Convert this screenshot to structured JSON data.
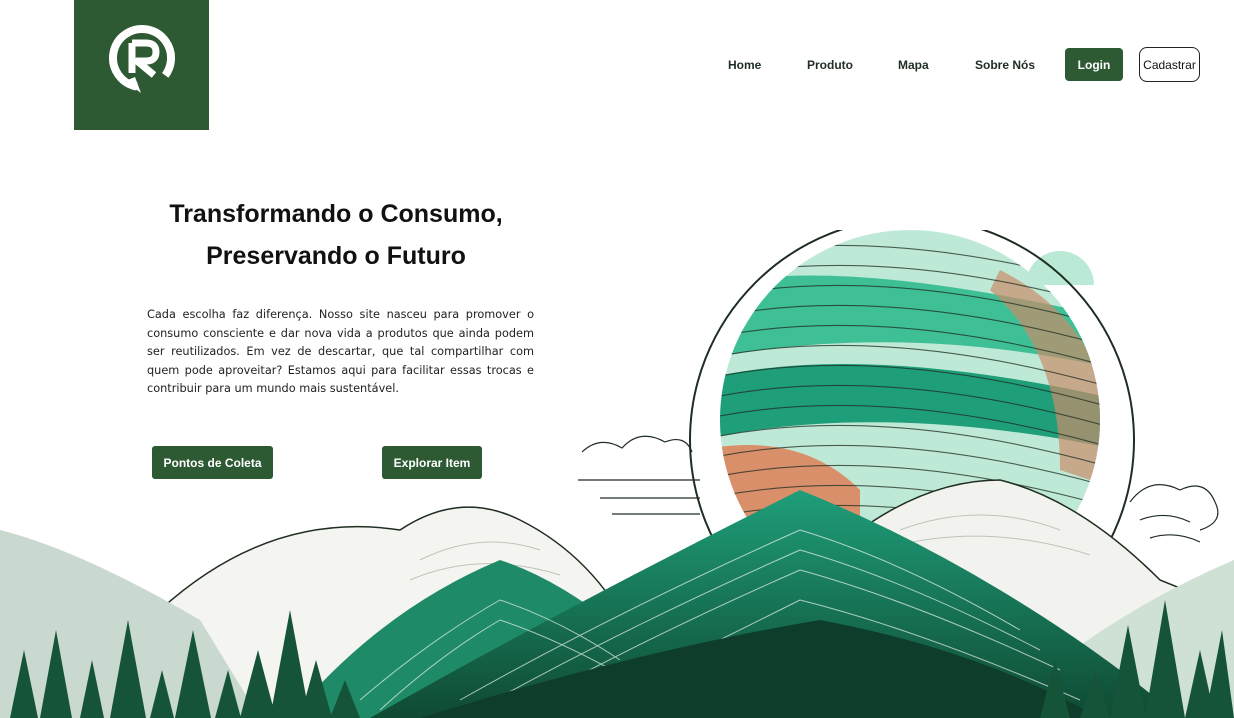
{
  "brand": {
    "logo_icon": "recycle-r-icon",
    "color": "#2d5a33"
  },
  "nav": {
    "items": [
      {
        "label": "Home"
      },
      {
        "label": "Produto"
      },
      {
        "label": "Mapa"
      },
      {
        "label": "Sobre Nós"
      }
    ],
    "login_label": "Login",
    "signup_label": "Cadastrar"
  },
  "hero": {
    "title_line1": "Transformando o Consumo,",
    "title_line2": "Preservando o Futuro",
    "description": "Cada escolha faz diferença. Nosso site nasceu para promover o consumo consciente e dar nova vida a produtos que ainda podem ser reutilizados. Em vez de descartar, que tal compartilhar com quem pode aproveitar? Estamos aqui para facilitar essas trocas e contribuir para um mundo mais sustentável.",
    "cta_primary": "Pontos de Coleta",
    "cta_secondary": "Explorar Item"
  },
  "colors": {
    "primary": "#2d5a33",
    "teal": "#1f9e7a",
    "mint": "#a9e3cc",
    "terracotta": "#d9906a"
  }
}
